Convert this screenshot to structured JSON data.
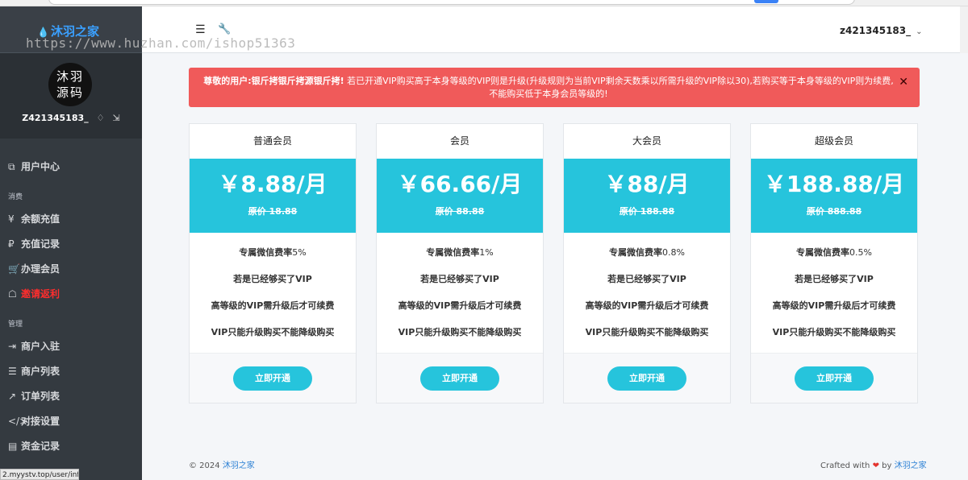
{
  "brand": {
    "name": "沐羽之家",
    "logo_text": "沐羽源码"
  },
  "watermark": "https://www.huzhan.com/ishop51363",
  "user": {
    "name": "Z421345183_",
    "topbar_name": "z421345183_"
  },
  "nav": [
    {
      "type": "item",
      "icon": "⧉",
      "label": "用户中心"
    },
    {
      "type": "header",
      "label": "消费"
    },
    {
      "type": "item",
      "icon": "¥",
      "label": "余额充值"
    },
    {
      "type": "item",
      "icon": "₽",
      "label": "充值记录"
    },
    {
      "type": "item",
      "icon": "🛒",
      "label": "办理会员"
    },
    {
      "type": "item",
      "icon": "☖",
      "label": "邀请返利",
      "highlight": "#ff2d2d"
    },
    {
      "type": "header",
      "label": "管理"
    },
    {
      "type": "item",
      "icon": "⇥",
      "label": "商户入驻"
    },
    {
      "type": "item",
      "icon": "☰",
      "label": "商户列表"
    },
    {
      "type": "item",
      "icon": "↗",
      "label": "订单列表"
    },
    {
      "type": "item",
      "icon": "</>",
      "label": "对接设置"
    },
    {
      "type": "item",
      "icon": "▤",
      "label": "资金记录"
    }
  ],
  "status_url": "2.myystv.top/user/info",
  "alert": {
    "strong": "尊敬的用户:银斤拷银斤拷源银斤拷!",
    "text": " 若已开通VIP购买高于本身等级的VIP则是升级(升级规则为当前VIP剩余天数乘以所需升级的VIP除以30),若购买等于本身等级的VIP则为续费,不能购买低于本身会员等级的!"
  },
  "plans": [
    {
      "title": "普通会员",
      "price": "￥8.88/月",
      "original": "原价 18.88",
      "rate_label": "专属微信费率",
      "rate": "5%"
    },
    {
      "title": "会员",
      "price": "￥66.66/月",
      "original": "原价 88.88",
      "rate_label": "专属微信费率",
      "rate": "1%"
    },
    {
      "title": "大会员",
      "price": "￥88/月",
      "original": "原价 188.88",
      "rate_label": "专属微信费率",
      "rate": "0.8%"
    },
    {
      "title": "超级会员",
      "price": "￥188.88/月",
      "original": "原价 888.88",
      "rate_label": "专属微信费率",
      "rate": "0.5%"
    }
  ],
  "plan_features": [
    "若是已经够买了VIP",
    "高等级的VIP需升级后才可续费",
    "VIP只能升级购买不能降级购买"
  ],
  "plan_button": "立即开通",
  "footer": {
    "copyright_prefix": "© 2024 ",
    "copyright_link": "沐羽之家",
    "crafted_prefix": "Crafted with ",
    "crafted_by": " by ",
    "crafted_link": "沐羽之家"
  },
  "colors": {
    "accent": "#26c4dc",
    "alert": "#f05a5a",
    "sidebar": "#343a40",
    "link": "#2a7fd4"
  }
}
